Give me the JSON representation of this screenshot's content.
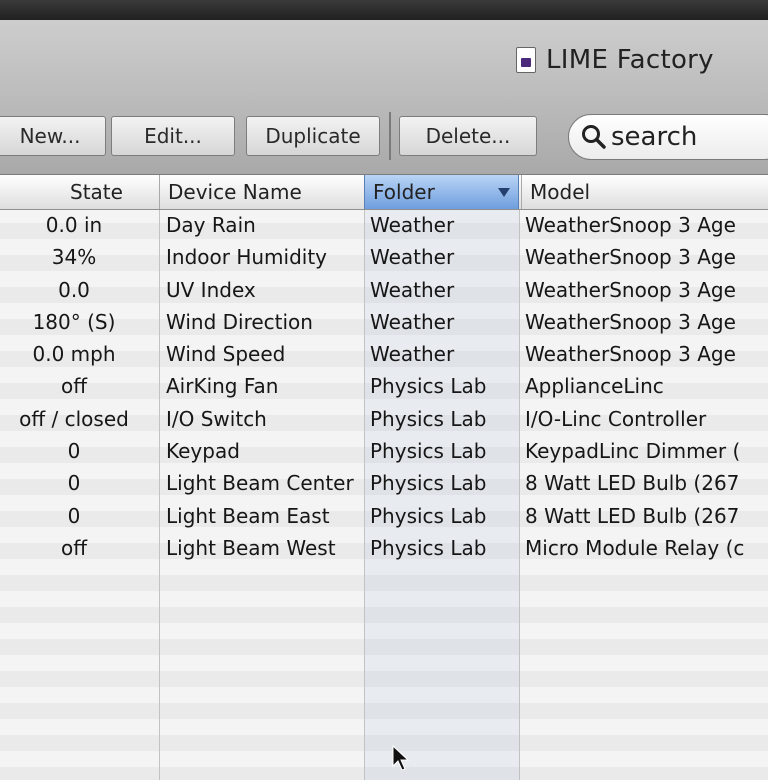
{
  "window": {
    "title": "LIME Factory"
  },
  "toolbar": {
    "new_label": "New...",
    "edit_label": "Edit...",
    "duplicate_label": "Duplicate",
    "delete_label": "Delete...",
    "search_placeholder": "search"
  },
  "table": {
    "columns": [
      "State",
      "Device Name",
      "Folder",
      "Model"
    ],
    "sorted_column": "Folder",
    "rows": [
      {
        "state": "0.0 in",
        "name": "Day Rain",
        "folder": "Weather",
        "model": "WeatherSnoop 3 Age"
      },
      {
        "state": "34%",
        "name": "Indoor Humidity",
        "folder": "Weather",
        "model": "WeatherSnoop 3 Age"
      },
      {
        "state": "0.0",
        "name": "UV Index",
        "folder": "Weather",
        "model": "WeatherSnoop 3 Age"
      },
      {
        "state": "180° (S)",
        "name": "Wind Direction",
        "folder": "Weather",
        "model": "WeatherSnoop 3 Age"
      },
      {
        "state": "0.0 mph",
        "name": "Wind Speed",
        "folder": "Weather",
        "model": "WeatherSnoop 3 Age"
      },
      {
        "state": "off",
        "name": "AirKing Fan",
        "folder": "Physics Lab",
        "model": "ApplianceLinc"
      },
      {
        "state": "off / closed",
        "name": "I/O Switch",
        "folder": "Physics Lab",
        "model": "I/O-Linc Controller"
      },
      {
        "state": "0",
        "name": "Keypad",
        "folder": "Physics Lab",
        "model": "KeypadLinc Dimmer ("
      },
      {
        "state": "0",
        "name": "Light Beam Center",
        "folder": "Physics Lab",
        "model": "8 Watt LED Bulb (267"
      },
      {
        "state": "0",
        "name": "Light Beam East",
        "folder": "Physics Lab",
        "model": "8 Watt LED Bulb (267"
      },
      {
        "state": "off",
        "name": "Light Beam West",
        "folder": "Physics Lab",
        "model": "Micro Module Relay (c"
      }
    ]
  },
  "colors": {
    "header_selected": "#8fb3e8",
    "row_alt": "#eaeaea"
  }
}
